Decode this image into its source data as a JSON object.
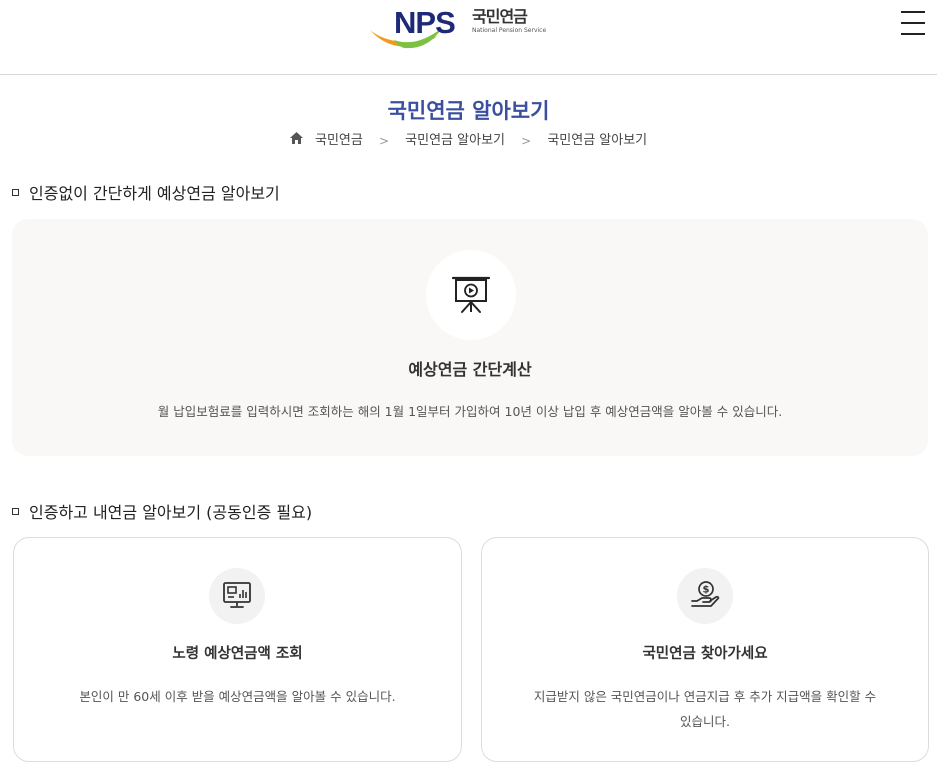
{
  "header": {
    "logo_text": "NPS",
    "logo_org_kr": "국민연금",
    "logo_org_en": "National Pension Service"
  },
  "page": {
    "title": "국민연금 알아보기"
  },
  "breadcrumb": {
    "items": [
      "국민연금",
      "국민연금 알아보기",
      "국민연금 알아보기"
    ],
    "separator": ">"
  },
  "section1": {
    "title": "인증없이 간단하게 예상연금 알아보기",
    "card": {
      "icon": "presentation-play-icon",
      "title": "예상연금 간단계산",
      "description": "월 납입보험료를 입력하시면 조회하는 해의 1월 1일부터 가입하여 10년 이상 납입 후 예상연금액을 알아볼 수 있습니다."
    }
  },
  "section2": {
    "title": "인증하고 내연금 알아보기 (공동인증 필요)",
    "cards": [
      {
        "icon": "monitor-chart-icon",
        "title": "노령 예상연금액 조회",
        "description": "본인이 만 60세 이후 받을 예상연금액을 알아볼 수 있습니다."
      },
      {
        "icon": "hand-coin-icon",
        "title": "국민연금 찾아가세요",
        "description_line1": "지급받지 않은 국민연금이나 연금지급 후 추가 지급액을 확인할 수",
        "description_line2": "있습니다."
      }
    ]
  },
  "colors": {
    "title_blue": "#3b4fa0",
    "logo_navy": "#1e2a78",
    "logo_orange": "#f39a1e",
    "logo_green": "#7cc242",
    "card_bg": "#faf8f6",
    "icon_circle_bg": "#f2f2f2"
  }
}
